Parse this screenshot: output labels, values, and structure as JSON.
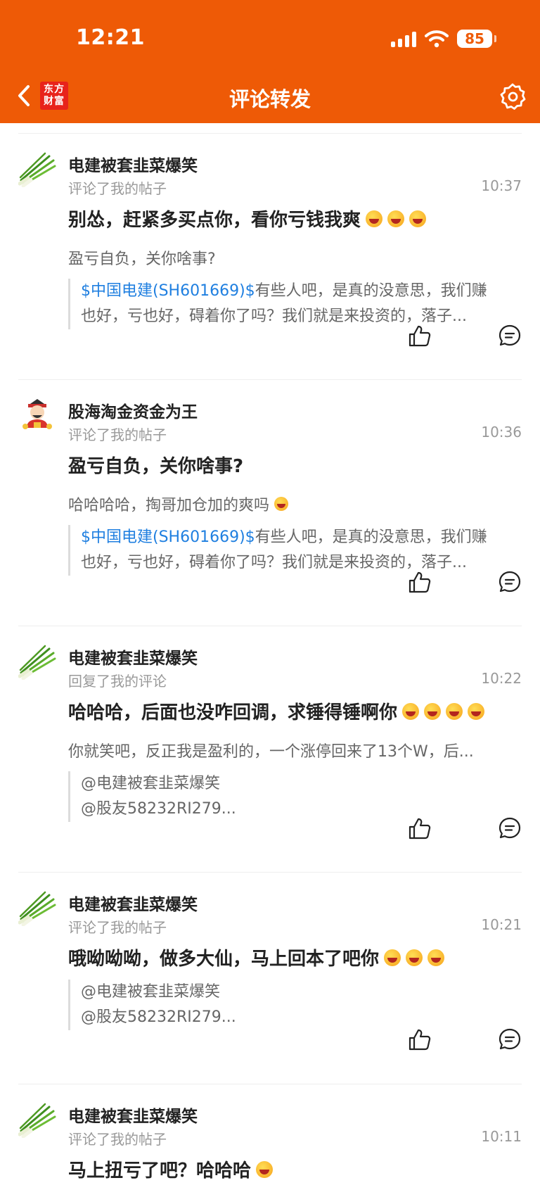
{
  "status_bar": {
    "time": "12:21",
    "battery": "85"
  },
  "header": {
    "title": "评论转发",
    "logo_line1": "东方",
    "logo_line2": "财富"
  },
  "colors": {
    "brand": "#ee5a06",
    "link": "#1f7fe0"
  },
  "icons": [
    "back-arrow-icon",
    "settings-gear-icon",
    "thumbs-up-icon",
    "comment-bubble-icon",
    "laughing-emoji-icon"
  ],
  "items": [
    {
      "avatar": "chives-avatar",
      "username": "电建被套韭菜爆笑",
      "action": "评论了我的帖子",
      "time": "10:37",
      "main": "别怂，赶紧多买点你，看你亏钱我爽",
      "sub": "盈亏自负，关你啥事?",
      "quote_link": "$中国电建(SH601669)$",
      "quote_line1": "有些人吧，是真的没意思，我们赚",
      "quote_line2": "也好，亏也好，碍着你了吗？我们就是来投资的，落子..."
    },
    {
      "avatar": "god-of-wealth-avatar",
      "username": "股海淘金资金为王",
      "action": "评论了我的帖子",
      "time": "10:36",
      "main": "盈亏自负，关你啥事?",
      "sub": "哈哈哈哈，掏哥加仓加的爽吗",
      "quote_link": "$中国电建(SH601669)$",
      "quote_line1": "有些人吧，是真的没意思，我们赚",
      "quote_line2": "也好，亏也好，碍着你了吗？我们就是来投资的，落子..."
    },
    {
      "avatar": "chives-avatar",
      "username": "电建被套韭菜爆笑",
      "action": "回复了我的评论",
      "time": "10:22",
      "main": "哈哈哈，后面也没咋回调，求锤得锤啊你",
      "sub": "你就笑吧，反正我是盈利的，一个涨停回来了13个W，后...",
      "quote_line1": "@电建被套韭菜爆笑",
      "quote_line2": "@股友58232RI279..."
    },
    {
      "avatar": "chives-avatar",
      "username": "电建被套韭菜爆笑",
      "action": "评论了我的帖子",
      "time": "10:21",
      "main": "哦呦呦呦，做多大仙，马上回本了吧你",
      "quote_line1": "@电建被套韭菜爆笑",
      "quote_line2": "@股友58232RI279..."
    },
    {
      "avatar": "chives-avatar",
      "username": "电建被套韭菜爆笑",
      "action": "评论了我的帖子",
      "time": "10:11",
      "main": "马上扭亏了吧？哈哈哈"
    }
  ]
}
